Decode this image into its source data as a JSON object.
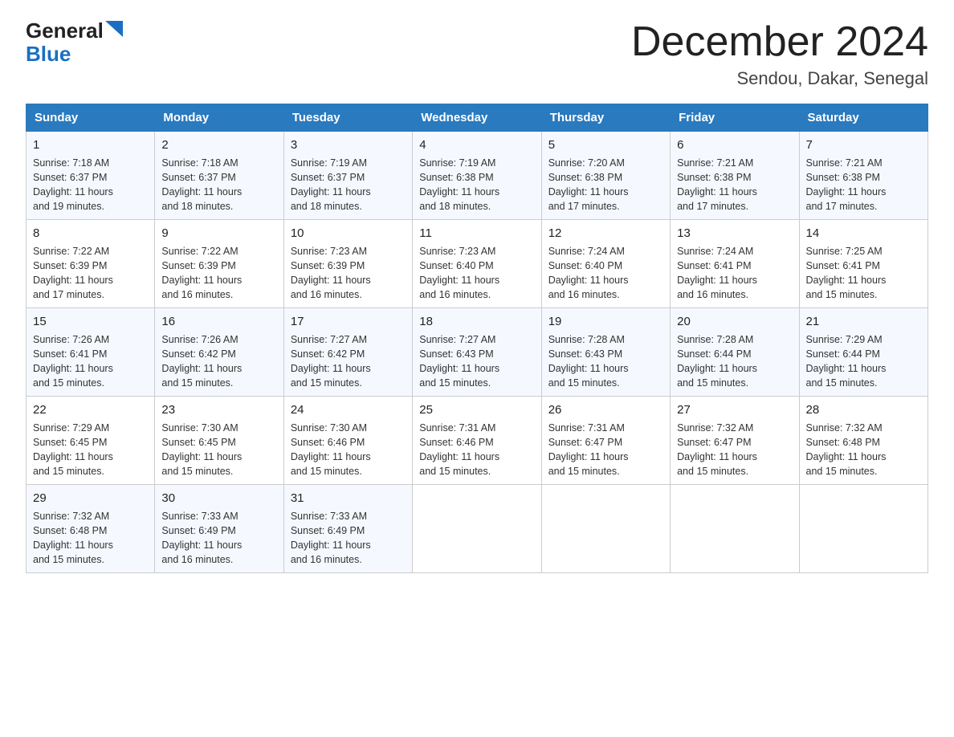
{
  "logo": {
    "general": "General",
    "blue": "Blue",
    "triangle": "▶"
  },
  "title": {
    "main": "December 2024",
    "sub": "Sendou, Dakar, Senegal"
  },
  "headers": [
    "Sunday",
    "Monday",
    "Tuesday",
    "Wednesday",
    "Thursday",
    "Friday",
    "Saturday"
  ],
  "weeks": [
    [
      {
        "day": "1",
        "info": "Sunrise: 7:18 AM\nSunset: 6:37 PM\nDaylight: 11 hours\nand 19 minutes."
      },
      {
        "day": "2",
        "info": "Sunrise: 7:18 AM\nSunset: 6:37 PM\nDaylight: 11 hours\nand 18 minutes."
      },
      {
        "day": "3",
        "info": "Sunrise: 7:19 AM\nSunset: 6:37 PM\nDaylight: 11 hours\nand 18 minutes."
      },
      {
        "day": "4",
        "info": "Sunrise: 7:19 AM\nSunset: 6:38 PM\nDaylight: 11 hours\nand 18 minutes."
      },
      {
        "day": "5",
        "info": "Sunrise: 7:20 AM\nSunset: 6:38 PM\nDaylight: 11 hours\nand 17 minutes."
      },
      {
        "day": "6",
        "info": "Sunrise: 7:21 AM\nSunset: 6:38 PM\nDaylight: 11 hours\nand 17 minutes."
      },
      {
        "day": "7",
        "info": "Sunrise: 7:21 AM\nSunset: 6:38 PM\nDaylight: 11 hours\nand 17 minutes."
      }
    ],
    [
      {
        "day": "8",
        "info": "Sunrise: 7:22 AM\nSunset: 6:39 PM\nDaylight: 11 hours\nand 17 minutes."
      },
      {
        "day": "9",
        "info": "Sunrise: 7:22 AM\nSunset: 6:39 PM\nDaylight: 11 hours\nand 16 minutes."
      },
      {
        "day": "10",
        "info": "Sunrise: 7:23 AM\nSunset: 6:39 PM\nDaylight: 11 hours\nand 16 minutes."
      },
      {
        "day": "11",
        "info": "Sunrise: 7:23 AM\nSunset: 6:40 PM\nDaylight: 11 hours\nand 16 minutes."
      },
      {
        "day": "12",
        "info": "Sunrise: 7:24 AM\nSunset: 6:40 PM\nDaylight: 11 hours\nand 16 minutes."
      },
      {
        "day": "13",
        "info": "Sunrise: 7:24 AM\nSunset: 6:41 PM\nDaylight: 11 hours\nand 16 minutes."
      },
      {
        "day": "14",
        "info": "Sunrise: 7:25 AM\nSunset: 6:41 PM\nDaylight: 11 hours\nand 15 minutes."
      }
    ],
    [
      {
        "day": "15",
        "info": "Sunrise: 7:26 AM\nSunset: 6:41 PM\nDaylight: 11 hours\nand 15 minutes."
      },
      {
        "day": "16",
        "info": "Sunrise: 7:26 AM\nSunset: 6:42 PM\nDaylight: 11 hours\nand 15 minutes."
      },
      {
        "day": "17",
        "info": "Sunrise: 7:27 AM\nSunset: 6:42 PM\nDaylight: 11 hours\nand 15 minutes."
      },
      {
        "day": "18",
        "info": "Sunrise: 7:27 AM\nSunset: 6:43 PM\nDaylight: 11 hours\nand 15 minutes."
      },
      {
        "day": "19",
        "info": "Sunrise: 7:28 AM\nSunset: 6:43 PM\nDaylight: 11 hours\nand 15 minutes."
      },
      {
        "day": "20",
        "info": "Sunrise: 7:28 AM\nSunset: 6:44 PM\nDaylight: 11 hours\nand 15 minutes."
      },
      {
        "day": "21",
        "info": "Sunrise: 7:29 AM\nSunset: 6:44 PM\nDaylight: 11 hours\nand 15 minutes."
      }
    ],
    [
      {
        "day": "22",
        "info": "Sunrise: 7:29 AM\nSunset: 6:45 PM\nDaylight: 11 hours\nand 15 minutes."
      },
      {
        "day": "23",
        "info": "Sunrise: 7:30 AM\nSunset: 6:45 PM\nDaylight: 11 hours\nand 15 minutes."
      },
      {
        "day": "24",
        "info": "Sunrise: 7:30 AM\nSunset: 6:46 PM\nDaylight: 11 hours\nand 15 minutes."
      },
      {
        "day": "25",
        "info": "Sunrise: 7:31 AM\nSunset: 6:46 PM\nDaylight: 11 hours\nand 15 minutes."
      },
      {
        "day": "26",
        "info": "Sunrise: 7:31 AM\nSunset: 6:47 PM\nDaylight: 11 hours\nand 15 minutes."
      },
      {
        "day": "27",
        "info": "Sunrise: 7:32 AM\nSunset: 6:47 PM\nDaylight: 11 hours\nand 15 minutes."
      },
      {
        "day": "28",
        "info": "Sunrise: 7:32 AM\nSunset: 6:48 PM\nDaylight: 11 hours\nand 15 minutes."
      }
    ],
    [
      {
        "day": "29",
        "info": "Sunrise: 7:32 AM\nSunset: 6:48 PM\nDaylight: 11 hours\nand 15 minutes."
      },
      {
        "day": "30",
        "info": "Sunrise: 7:33 AM\nSunset: 6:49 PM\nDaylight: 11 hours\nand 16 minutes."
      },
      {
        "day": "31",
        "info": "Sunrise: 7:33 AM\nSunset: 6:49 PM\nDaylight: 11 hours\nand 16 minutes."
      },
      null,
      null,
      null,
      null
    ]
  ]
}
